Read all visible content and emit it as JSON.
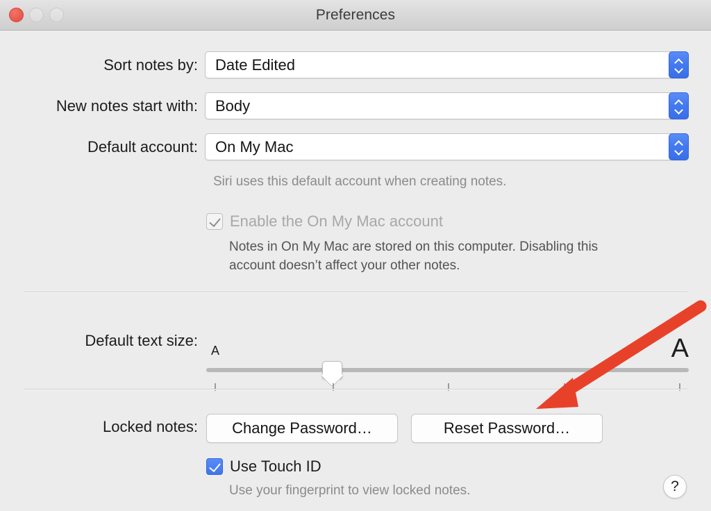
{
  "window": {
    "title": "Preferences",
    "traffic_lights": [
      {
        "name": "close",
        "state": "active"
      },
      {
        "name": "minimize",
        "state": "inactive"
      },
      {
        "name": "zoom",
        "state": "inactive"
      }
    ]
  },
  "form": {
    "sort_notes": {
      "label": "Sort notes by:",
      "value": "Date Edited"
    },
    "new_notes": {
      "label": "New notes start with:",
      "value": "Body"
    },
    "default_account": {
      "label": "Default account:",
      "value": "On My Mac",
      "caption": "Siri uses this default account when creating notes."
    },
    "enable_account": {
      "label": "Enable the On My Mac account",
      "checked": true,
      "enabled": false,
      "description_line1": "Notes in On My Mac are stored on this computer. Disabling this",
      "description_line2": "account doesn’t affect your other notes."
    }
  },
  "text_size": {
    "label": "Default text size:",
    "min_marker": "A",
    "max_marker": "A",
    "value_percent": 26,
    "tick_count": 5
  },
  "locked_notes": {
    "label": "Locked notes:",
    "change_password_label": "Change Password…",
    "reset_password_label": "Reset Password…",
    "touch_id": {
      "label": "Use Touch ID",
      "checked": true,
      "description": "Use your fingerprint to view locked notes."
    }
  },
  "help": {
    "glyph": "?"
  },
  "annotation": {
    "arrow_color": "#e8412a",
    "target": "reset-password-button"
  },
  "colors": {
    "accent_blue": "#4379ef",
    "window_bg": "#ececec",
    "titlebar_bg": "#d7d7d7",
    "close_red": "#e8564a",
    "annotation_red": "#e8412a"
  }
}
